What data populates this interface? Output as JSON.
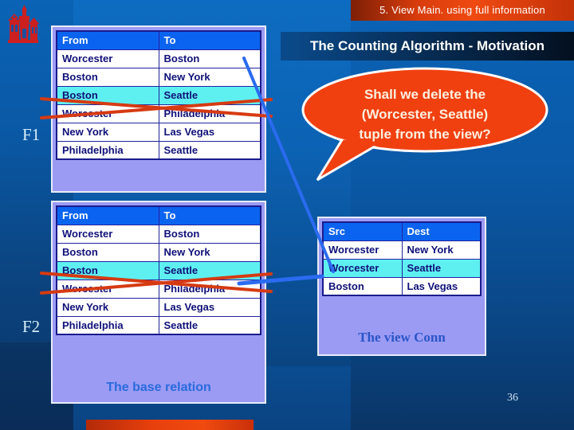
{
  "banner": {
    "text": "5. View Main. using full information"
  },
  "title": {
    "text": "The Counting Algorithm - Motivation"
  },
  "callout": {
    "line1": "Shall we delete the",
    "line2": "(Worcester, Seattle)",
    "line3": "tuple from the view?",
    "fill_color": "#f04010",
    "text_color": "#fdf0e0"
  },
  "logo": {
    "name": "university-castle-logo",
    "color": "#cc2020"
  },
  "tables": {
    "f1": {
      "label": "F1",
      "headers": [
        "From",
        "To"
      ],
      "rows": [
        {
          "cells": [
            "Worcester",
            "Boston"
          ],
          "highlighted": false
        },
        {
          "cells": [
            "Boston",
            "New York"
          ],
          "highlighted": false
        },
        {
          "cells": [
            "Boston",
            "Seattle"
          ],
          "highlighted": true
        },
        {
          "cells": [
            "Worcester",
            "Philadelphia"
          ],
          "highlighted": false
        },
        {
          "cells": [
            "New York",
            "Las Vegas"
          ],
          "highlighted": false
        },
        {
          "cells": [
            "Philadelphia",
            "Seattle"
          ],
          "highlighted": false
        }
      ],
      "caption": ""
    },
    "f2": {
      "label": "F2",
      "headers": [
        "From",
        "To"
      ],
      "rows": [
        {
          "cells": [
            "Worcester",
            "Boston"
          ],
          "highlighted": false
        },
        {
          "cells": [
            "Boston",
            "New York"
          ],
          "highlighted": false
        },
        {
          "cells": [
            "Boston",
            "Seattle"
          ],
          "highlighted": true
        },
        {
          "cells": [
            "Worcester",
            "Philadelphia"
          ],
          "highlighted": false
        },
        {
          "cells": [
            "New York",
            "Las Vegas"
          ],
          "highlighted": false
        },
        {
          "cells": [
            "Philadelphia",
            "Seattle"
          ],
          "highlighted": false
        }
      ],
      "caption": "The base relation"
    },
    "view": {
      "headers": [
        "Src",
        "Dest"
      ],
      "rows": [
        {
          "cells": [
            "Worcester",
            "New York"
          ],
          "highlighted": false
        },
        {
          "cells": [
            "Worcester",
            "Seattle"
          ],
          "highlighted": true
        },
        {
          "cells": [
            "Boston",
            "Las Vegas"
          ],
          "highlighted": false
        }
      ],
      "caption": "The view Conn"
    }
  },
  "annotations": {
    "strike_color": "#d63a12",
    "arrow_color": "#2a6bf0"
  },
  "page_number": "36"
}
